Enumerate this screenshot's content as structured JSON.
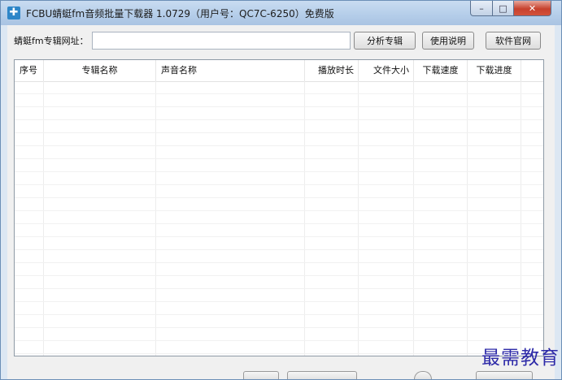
{
  "window": {
    "title": "FCBU蜻蜓fm音频批量下载器 1.0729（用户号：QC7C-6250）免费版",
    "controls": {
      "minimize": "–",
      "maximize": "□",
      "close": "✕"
    }
  },
  "toolbar": {
    "url_label": "蜻蜓fm专辑网址：",
    "url_value": "",
    "analyze_label": "分析专辑",
    "help_label": "使用说明",
    "site_label": "软件官网"
  },
  "table": {
    "columns": [
      "序号",
      "专辑名称",
      "声音名称",
      "播放时长",
      "文件大小",
      "下载速度",
      "下载进度"
    ],
    "rows": []
  },
  "watermark": "最需教育",
  "colors": {
    "title_bar": "#b4cde9",
    "close_button": "#c7412d",
    "watermark": "#2d2aa8"
  }
}
